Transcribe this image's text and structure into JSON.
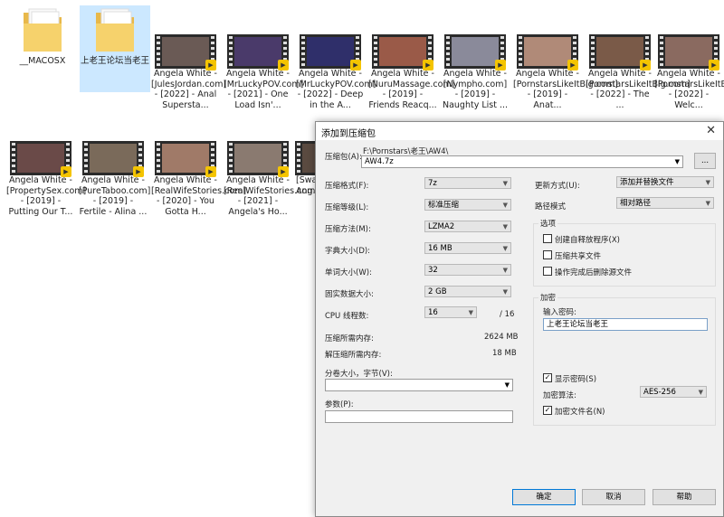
{
  "files_row1": [
    {
      "type": "folder",
      "caption": "__MACOSX"
    },
    {
      "type": "folder",
      "caption": "上老王论坛当老王",
      "selected": true
    },
    {
      "type": "video",
      "caption": "Angela White - [JulesJordan.com] - [2022] - Anal Supersta...",
      "color": "#6a5a55"
    },
    {
      "type": "video",
      "caption": "Angela White - [MrLuckyPOV.com] - [2021] - One Load Isn'...",
      "color": "#4a3a6a"
    },
    {
      "type": "video",
      "caption": "Angela White - [MrLuckyPOV.com] - [2022] - Deep in the A...",
      "color": "#2f2f6a"
    },
    {
      "type": "video",
      "caption": "Angela White - [NuruMassage.com] - [2019] - Friends Reacq...",
      "color": "#9a5a48"
    },
    {
      "type": "video",
      "caption": "Angela White - [Nympho.com] - [2019] - Naughty List ...",
      "color": "#8a8a9a"
    },
    {
      "type": "video",
      "caption": "Angela White - [PornstarsLikeItBig.com] - [2019] - Anat...",
      "color": "#b08a78"
    },
    {
      "type": "video",
      "caption": "Angela White - [PornstarsLikeItBig.com] - [2022] - The ...",
      "color": "#7a5a48"
    },
    {
      "type": "video",
      "caption": "Angela White - [PornstarsLikeItBig.com] - [2022] - Welc...",
      "color": "#8a6a60"
    }
  ],
  "files_row2": [
    {
      "caption": "Angela White - [PropertySex.com] - [2019] - Putting Our T...",
      "color": "#6a4a48"
    },
    {
      "caption": "Angela White - [PureTaboo.com] - [2019] - Fertile - Alina ...",
      "color": "#7a6a5a"
    },
    {
      "caption": "Angela White - [RealWifeStories.com] - [2020] - You Gotta H...",
      "color": "#a07a68"
    },
    {
      "caption": "Angela White - [RealWifeStories.com] - [2021] - Angela's Ho...",
      "color": "#8a7a70"
    },
    {
      "caption": "[Swa... Ang...",
      "color": "#5a4a40"
    }
  ],
  "dialog": {
    "title": "添加到压缩包",
    "archive_label": "压缩包(A):",
    "archive_path": "F:\\Pornstars\\老王\\AW4\\",
    "archive_name": "AW4.7z",
    "browse": "...",
    "format_label": "压缩格式(F):",
    "format_value": "7z",
    "level_label": "压缩等级(L):",
    "level_value": "标准压缩",
    "method_label": "压缩方法(M):",
    "method_value": "LZMA2",
    "dict_label": "字典大小(D):",
    "dict_value": "16 MB",
    "word_label": "单词大小(W):",
    "word_value": "32",
    "solid_label": "固实数据大小:",
    "solid_value": "2 GB",
    "cpu_label": "CPU 线程数:",
    "cpu_value": "16",
    "cpu_max": "/ 16",
    "mem_comp_label": "压缩所需内存:",
    "mem_comp_value": "2624 MB",
    "mem_decomp_label": "解压缩所需内存:",
    "mem_decomp_value": "18 MB",
    "split_label": "分卷大小，字节(V):",
    "params_label": "参数(P):",
    "update_label": "更新方式(U):",
    "update_value": "添加并替换文件",
    "path_label": "路径模式",
    "path_value": "相对路径",
    "options_title": "选项",
    "opt_sfx": "创建自释放程序(X)",
    "opt_shared": "压缩共享文件",
    "opt_delete": "操作完成后删除源文件",
    "enc_title": "加密",
    "pwd_label": "输入密码:",
    "pwd_value": "上老王论坛当老王",
    "show_pwd": "显示密码(S)",
    "enc_method_label": "加密算法:",
    "enc_method_value": "AES-256",
    "enc_names": "加密文件名(N)",
    "ok": "确定",
    "cancel": "取消",
    "help": "帮助"
  }
}
